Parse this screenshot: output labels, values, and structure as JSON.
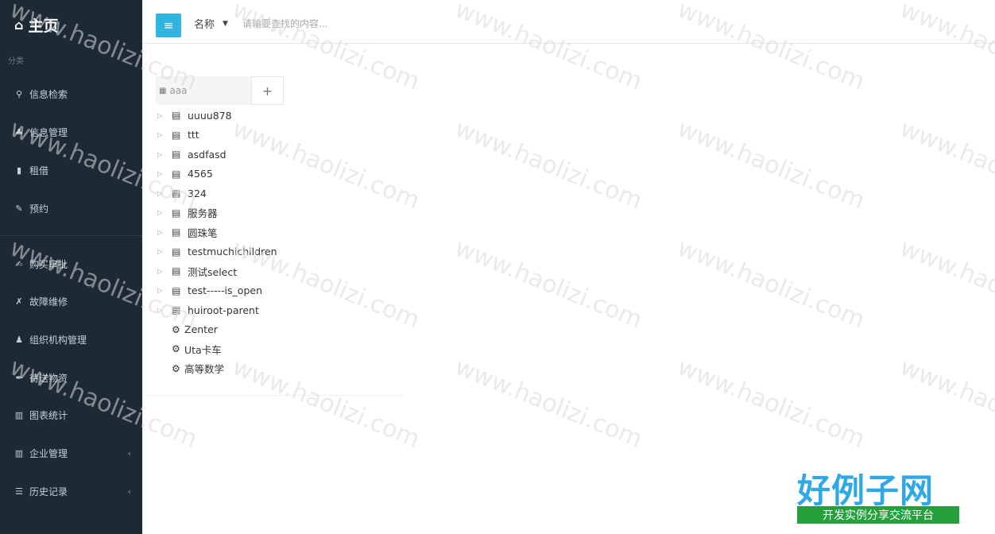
{
  "sidebar": {
    "title": "主页",
    "section": "分类",
    "items": [
      {
        "label": "信息检索",
        "icon": "search-icon",
        "glyph": "🔍"
      },
      {
        "label": "信息管理",
        "icon": "sitemap-icon",
        "glyph": "♣"
      },
      {
        "label": "租借",
        "icon": "bookmark-icon",
        "glyph": "▮"
      },
      {
        "label": "预约",
        "icon": "pencil-icon",
        "glyph": "✎"
      },
      {
        "label": "购买审批",
        "icon": "edit-icon",
        "glyph": "✍"
      },
      {
        "label": "故障维修",
        "icon": "wrench-icon",
        "glyph": "🔧"
      },
      {
        "label": "组织机构管理",
        "icon": "users-icon",
        "glyph": "👥"
      },
      {
        "label": "待送物资",
        "icon": "pen-icon",
        "glyph": "✒"
      },
      {
        "label": "图表统计",
        "icon": "bar-chart-icon",
        "glyph": "▥"
      },
      {
        "label": "企业管理",
        "icon": "bar-chart-icon",
        "glyph": "▥"
      },
      {
        "label": "历史记录",
        "icon": "list-icon",
        "glyph": "☰"
      }
    ]
  },
  "header": {
    "search_type": "名称",
    "search_placeholder": "请输要查找的内容..."
  },
  "tree": {
    "title": "aaa",
    "nodes": [
      {
        "label": "uuuu878",
        "kind": "folder"
      },
      {
        "label": "ttt",
        "kind": "folder"
      },
      {
        "label": "asdfasd",
        "kind": "folder"
      },
      {
        "label": "4565",
        "kind": "folder"
      },
      {
        "label": "324",
        "kind": "folder"
      },
      {
        "label": "服务器",
        "kind": "folder"
      },
      {
        "label": "圆珠笔",
        "kind": "folder"
      },
      {
        "label": "testmuchichildren",
        "kind": "folder"
      },
      {
        "label": "测试select",
        "kind": "folder"
      },
      {
        "label": "test-----is_open",
        "kind": "folder"
      },
      {
        "label": "huiroot-parent",
        "kind": "folder"
      },
      {
        "label": "Zenter",
        "kind": "leaf"
      },
      {
        "label": "Uta卡车",
        "kind": "leaf"
      },
      {
        "label": "高等数学",
        "kind": "leaf"
      }
    ]
  },
  "watermark": {
    "text": "www.haolizi.com",
    "logo_main": "好例子网",
    "logo_sub": "开发实例分享交流平台"
  },
  "colors": {
    "sidebar_bg": "#1d2a35",
    "accent": "#2fb5e0"
  }
}
